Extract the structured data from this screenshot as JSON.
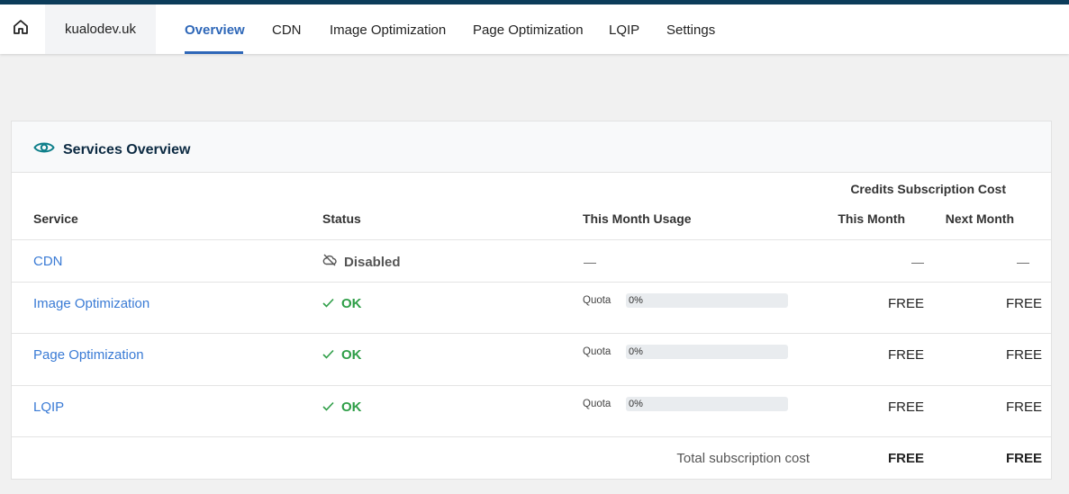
{
  "nav": {
    "home_icon": "home-icon",
    "domain": "kualodev.uk",
    "tabs": [
      {
        "label": "Overview",
        "active": true
      },
      {
        "label": "CDN",
        "active": false
      },
      {
        "label": "Image Optimization",
        "active": false
      },
      {
        "label": "Page Optimization",
        "active": false
      },
      {
        "label": "LQIP",
        "active": false
      },
      {
        "label": "Settings",
        "active": false
      }
    ]
  },
  "card": {
    "icon": "eye-icon",
    "title": "Services Overview"
  },
  "table": {
    "group_header": "Credits Subscription Cost",
    "columns": {
      "service": "Service",
      "status": "Status",
      "usage": "This Month Usage",
      "this_month": "This Month",
      "next_month": "Next Month"
    },
    "rows": [
      {
        "service": "CDN",
        "status": "Disabled",
        "status_icon": "cloud-off-icon",
        "usage": "—",
        "this_month": "—",
        "next_month": "—"
      },
      {
        "service": "Image Optimization",
        "status": "OK",
        "status_icon": "check-icon",
        "quota_label": "Quota",
        "quota_pct": "0%",
        "quota_value": 0,
        "this_month": "FREE",
        "next_month": "FREE"
      },
      {
        "service": "Page Optimization",
        "status": "OK",
        "status_icon": "check-icon",
        "quota_label": "Quota",
        "quota_pct": "0%",
        "quota_value": 0,
        "this_month": "FREE",
        "next_month": "FREE"
      },
      {
        "service": "LQIP",
        "status": "OK",
        "status_icon": "check-icon",
        "quota_label": "Quota",
        "quota_pct": "0%",
        "quota_value": 0,
        "this_month": "FREE",
        "next_month": "FREE"
      }
    ],
    "total": {
      "label": "Total subscription cost",
      "this_month": "FREE",
      "next_month": "FREE"
    }
  },
  "colors": {
    "accent": "#2e67b8",
    "link": "#3a7bd5",
    "ok": "#2e9e47",
    "top_stripe": "#0c3c5a"
  }
}
